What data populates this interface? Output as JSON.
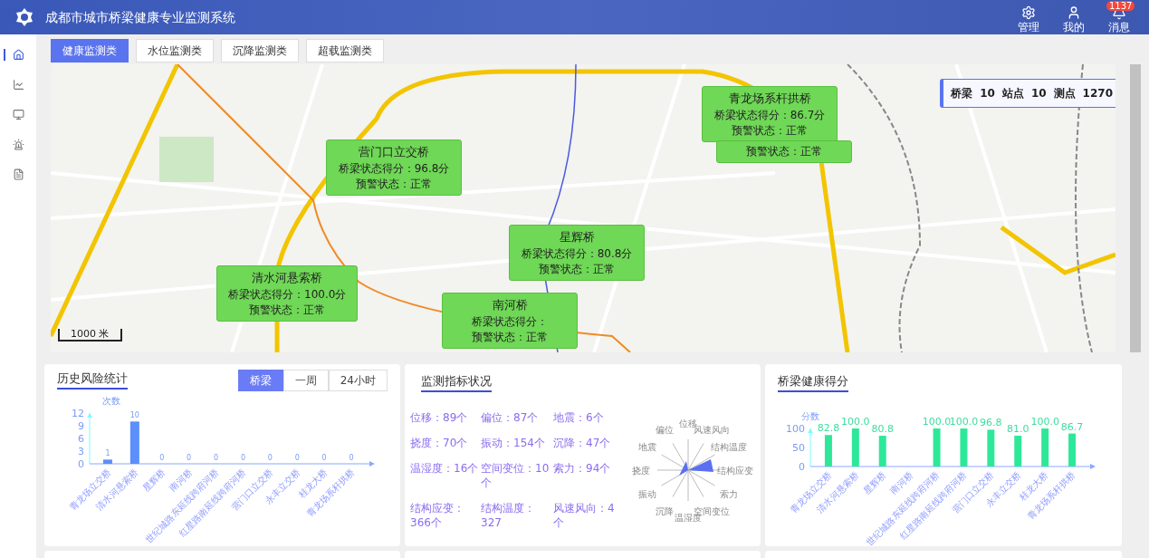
{
  "header": {
    "title": "成都市城市桥梁健康专业监测系统",
    "actions": [
      {
        "kind": "gear",
        "label": "管理"
      },
      {
        "kind": "user",
        "label": "我的"
      },
      {
        "kind": "bell",
        "label": "消息",
        "badge": "1137"
      }
    ]
  },
  "sidebar": {
    "items": [
      {
        "kind": "home",
        "selected": true
      },
      {
        "kind": "chart",
        "selected": false
      },
      {
        "kind": "monitor",
        "selected": false
      },
      {
        "kind": "alarm",
        "selected": false
      },
      {
        "kind": "doc",
        "selected": false
      }
    ]
  },
  "tabs": [
    {
      "label": "健康监测类",
      "selected": true
    },
    {
      "label": "水位监测类",
      "selected": false
    },
    {
      "label": "沉降监测类",
      "selected": false
    },
    {
      "label": "超载监测类",
      "selected": false
    }
  ],
  "map": {
    "scale": "1000 米",
    "summary": [
      {
        "label": "桥梁",
        "value": "10"
      },
      {
        "label": "站点",
        "value": "10"
      },
      {
        "label": "测点",
        "value": "1270"
      }
    ],
    "popups": [
      {
        "title": "营门口立交桥",
        "score": "桥梁状态得分：96.8分",
        "warning": "预警状态：正常"
      },
      {
        "title": "星辉桥",
        "score": "桥梁状态得分：80.8分",
        "warning": "预警状态：正常"
      },
      {
        "title": "清水河悬索桥",
        "score": "桥梁状态得分：100.0分",
        "warning": "预警状态：正常"
      },
      {
        "title": "南河桥",
        "score": "桥梁状态得分：",
        "warning": "预警状态：正常"
      },
      {
        "title": "青龙场系杆拱桥",
        "score": "桥梁状态得分：86.7分",
        "warning": "预警状态：正常"
      },
      {
        "warning": "预警状态：正常"
      }
    ]
  },
  "risk": {
    "title": "历史风险统计",
    "toggles": [
      {
        "label": "桥梁",
        "selected": true
      },
      {
        "label": "一周",
        "selected": false
      },
      {
        "label": "24小时",
        "selected": false
      }
    ],
    "chart_data": {
      "type": "bar",
      "ylabel": "次数",
      "categories": [
        "青龙场立交桥",
        "清水河悬索桥",
        "星辉桥",
        "南河桥",
        "世纪城路东延线跨府河桥",
        "红星路南延线跨府河桥",
        "营门口立交桥",
        "永丰立交桥",
        "桂龙大桥",
        "青龙场系杆拱桥"
      ],
      "series": [
        {
          "color": "#5b8ff9",
          "values": [
            1,
            10,
            0,
            0,
            0,
            0,
            0,
            0,
            0,
            0
          ]
        }
      ],
      "ylim": [
        0,
        12
      ],
      "yticks": [
        0,
        3,
        6,
        9,
        12
      ],
      "data_labels": true
    }
  },
  "metrics": {
    "title": "监测指标状况",
    "items": [
      "位移：89个",
      "偏位：87个",
      "地震：6个",
      "挠度：70个",
      "振动：154个",
      "沉降：47个",
      "温湿度：16个",
      "空间变位：10个",
      "索力：94个",
      "结构应变：366个",
      "结构温度：327",
      "风速风向：4个"
    ],
    "radar_axes": [
      "位移",
      "风速风向",
      "结构温度",
      "结构应变",
      "索力",
      "空间变位",
      "温湿度",
      "沉降",
      "振动",
      "挠度",
      "地震",
      "偏位"
    ]
  },
  "health": {
    "title": "桥梁健康得分",
    "chart_data": {
      "type": "bar",
      "ylabel": "分数",
      "categories": [
        "青龙场立交桥",
        "清水河悬索桥",
        "星辉桥",
        "南河桥",
        "世纪城路东延线跨府河桥",
        "红星路南延线跨府河桥",
        "营门口立交桥",
        "永丰立交桥",
        "桂龙大桥",
        "青龙场系杆拱桥"
      ],
      "series": [
        {
          "color": "#2ee89a",
          "values": [
            82.8,
            100.0,
            80.8,
            null,
            100.0,
            100.0,
            96.8,
            81.0,
            100.0,
            86.7
          ]
        }
      ],
      "ylim": [
        0,
        100
      ],
      "yticks": [
        0,
        50,
        100
      ],
      "value_labels": [
        "82.8",
        "100.0",
        "80.8",
        null,
        "100.0",
        "100.0",
        "96.8",
        "81.0",
        "100.0",
        "86.7"
      ]
    }
  }
}
